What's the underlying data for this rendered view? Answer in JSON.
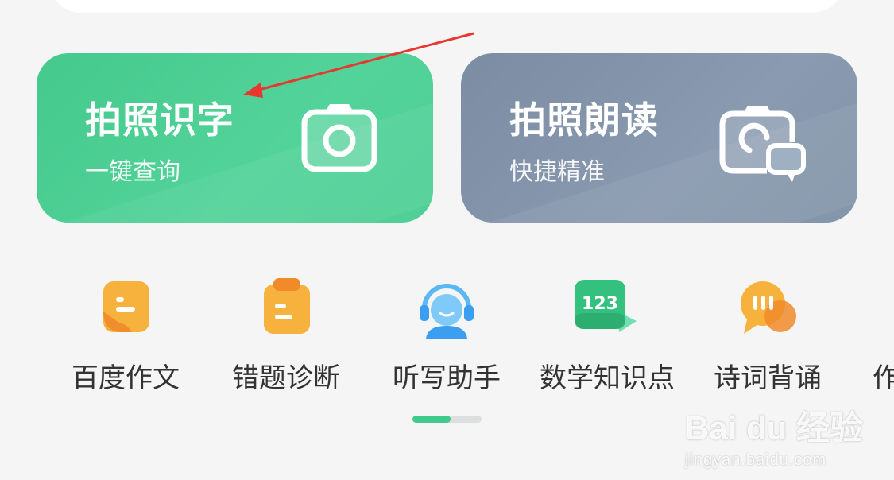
{
  "cards": [
    {
      "title": "拍照识字",
      "subtitle": "一键查询",
      "icon": "camera-icon",
      "color": "#4fcf95"
    },
    {
      "title": "拍照朗读",
      "subtitle": "快捷精准",
      "icon": "camera-speech-icon",
      "color": "#8395aa"
    }
  ],
  "tools": [
    {
      "label": "百度作文",
      "icon": "essay-icon"
    },
    {
      "label": "错题诊断",
      "icon": "clipboard-icon"
    },
    {
      "label": "听写助手",
      "icon": "headset-assistant-icon"
    },
    {
      "label": "数学知识点",
      "icon": "math-123-icon",
      "badge": "123"
    },
    {
      "label": "诗词背诵",
      "icon": "poetry-chat-icon"
    },
    {
      "label": "作"
    }
  ],
  "pager": {
    "progress": 0.55
  },
  "watermark": {
    "main": "Bai du 经验",
    "sub": "jingyan.baidu.com"
  },
  "colors": {
    "accent_green": "#3fc98a",
    "annotation_red": "#e8372e"
  }
}
